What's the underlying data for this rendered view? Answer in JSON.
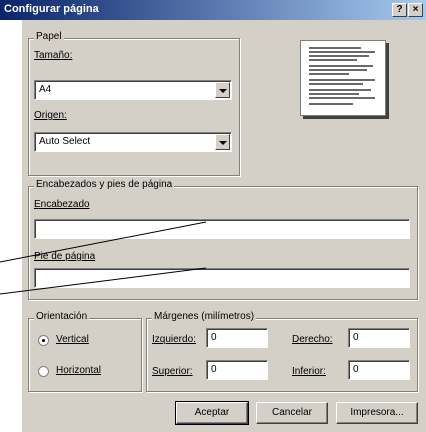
{
  "window": {
    "title": "Configurar página",
    "help_button": "?",
    "close_button": "×"
  },
  "paper": {
    "group_label": "Papel",
    "size_label": "Tamaño:",
    "size_value": "A4",
    "source_label": "Origen:",
    "source_value": "Auto Select"
  },
  "headers": {
    "group_label": "Encabezados y pies de página",
    "header_label": "Encabezado",
    "header_value": "",
    "footer_label": "Pie de página",
    "footer_value": ""
  },
  "orientation": {
    "group_label": "Orientación",
    "portrait_label": "Vertical",
    "landscape_label": "Horizontal",
    "selected": "Vertical"
  },
  "margins": {
    "group_label": "Márgenes (milímetros)",
    "left_label": "Izquierdo:",
    "left_value": "0",
    "right_label": "Derecho:",
    "right_value": "0",
    "top_label": "Superior:",
    "top_value": "0",
    "bottom_label": "Inferior:",
    "bottom_value": "0"
  },
  "buttons": {
    "ok": "Aceptar",
    "cancel": "Cancelar",
    "printer": "Impresora..."
  }
}
